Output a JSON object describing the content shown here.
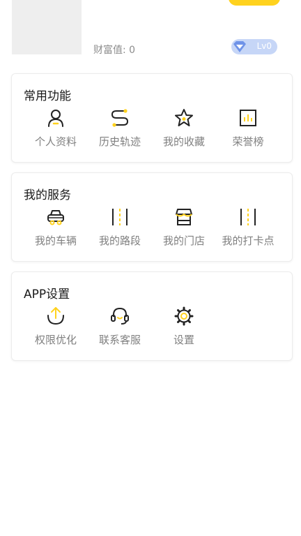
{
  "profile": {
    "wealth_label": "财富值: 0",
    "level": "Lv0"
  },
  "sections": {
    "common": {
      "title": "常用功能",
      "items": [
        {
          "label": "个人资料",
          "icon": "person-icon"
        },
        {
          "label": "历史轨迹",
          "icon": "route-icon"
        },
        {
          "label": "我的收藏",
          "icon": "star-icon"
        },
        {
          "label": "荣誉榜",
          "icon": "chart-icon"
        }
      ]
    },
    "services": {
      "title": "我的服务",
      "items": [
        {
          "label": "我的车辆",
          "icon": "car-icon"
        },
        {
          "label": "我的路段",
          "icon": "road-icon"
        },
        {
          "label": "我的门店",
          "icon": "store-icon"
        },
        {
          "label": "我的打卡点",
          "icon": "checkin-road-icon"
        }
      ]
    },
    "settings": {
      "title": "APP设置",
      "items": [
        {
          "label": "权限优化",
          "icon": "permission-icon"
        },
        {
          "label": "联系客服",
          "icon": "headset-icon"
        },
        {
          "label": "设置",
          "icon": "gear-icon"
        }
      ]
    }
  },
  "colors": {
    "accent": "#FFD21E",
    "icon_stroke": "#222222",
    "badge": "#C6D6F7"
  }
}
